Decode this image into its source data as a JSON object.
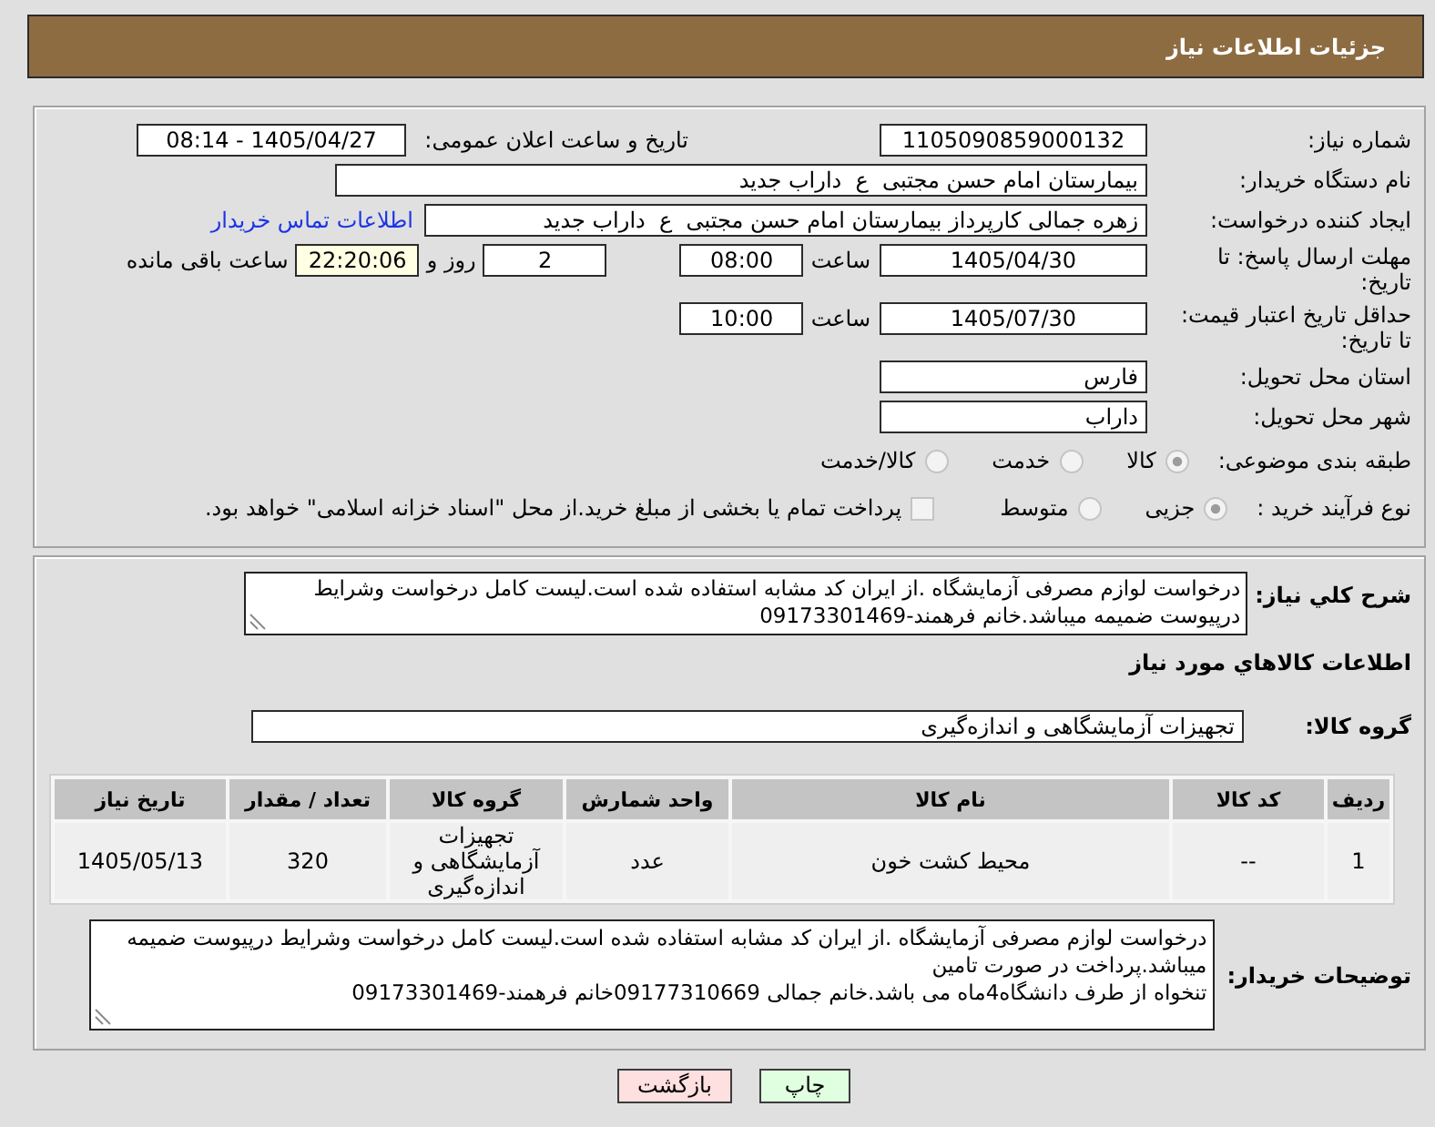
{
  "header": {
    "title": "جزئیات اطلاعات نیاز"
  },
  "details": {
    "need_number": {
      "label": "شماره نیاز:",
      "value": "1105090859000132"
    },
    "announcement": {
      "label": "تاریخ و ساعت اعلان عمومی:",
      "value": "1405/04/27 - 08:14"
    },
    "buyer_org": {
      "label": "نام دستگاه خریدار:",
      "value": "بیمارستان امام حسن مجتبی  ع  داراب جدید"
    },
    "requester": {
      "label": "ایجاد کننده درخواست:",
      "value": "زهره جمالی کارپرداز بیمارستان امام حسن مجتبی  ع  داراب جدید",
      "contact_link": "اطلاعات تماس خریدار"
    },
    "reply_deadline": {
      "label": "مهلت ارسال پاسخ: تا تاریخ:",
      "date": "1405/04/30",
      "time_label": "ساعت",
      "time": "08:00",
      "days": "2",
      "days_label": "روز و",
      "remaining": "22:20:06",
      "remaining_label": "ساعت باقی مانده"
    },
    "price_validity": {
      "label": "حداقل تاریخ اعتبار قیمت: تا تاریخ:",
      "date": "1405/07/30",
      "time_label": "ساعت",
      "time": "10:00"
    },
    "province": {
      "label": "استان محل تحویل:",
      "value": "فارس"
    },
    "city": {
      "label": "شهر محل تحویل:",
      "value": "داراب"
    },
    "category": {
      "label": "طبقه بندی موضوعی:",
      "options": [
        {
          "label": "کالا",
          "selected": true
        },
        {
          "label": "خدمت",
          "selected": false
        },
        {
          "label": "کالا/خدمت",
          "selected": false
        }
      ]
    },
    "process": {
      "label": "نوع فرآیند خرید :",
      "options": [
        {
          "label": "جزیی",
          "selected": true
        },
        {
          "label": "متوسط",
          "selected": false
        }
      ],
      "treasury_payment": {
        "label": "پرداخت تمام یا بخشی از مبلغ خرید.از محل \"اسناد خزانه اسلامی\" خواهد بود.",
        "checked": false
      }
    }
  },
  "description": {
    "label": "شرح کلي نياز:",
    "text": "درخواست لوازم مصرفی آزمایشگاه .از ایران کد مشابه استفاده شده است.لیست کامل درخواست وشرایط درپیوست ضمیمه میباشد.خانم فرهمند-09173301469"
  },
  "goods": {
    "title": "اطلاعات کالاهاي مورد نياز",
    "group_label": "گروه کالا:",
    "group": "تجهیزات آزمایشگاهی و اندازه‌گیری",
    "table": {
      "columns": [
        "ردیف",
        "کد کالا",
        "نام کالا",
        "واحد شمارش",
        "گروه کالا",
        "تعداد / مقدار",
        "تاریخ نیاز"
      ],
      "rows": [
        [
          "1",
          "--",
          "محیط کشت خون",
          "عدد",
          "تجهیزات آزمایشگاهی و اندازه‌گیری",
          "320",
          "1405/05/13"
        ]
      ]
    }
  },
  "buyer_notes": {
    "label": "توضیحات خریدار:",
    "text": "درخواست لوازم مصرفی آزمایشگاه .از ایران کد مشابه استفاده شده است.لیست کامل درخواست وشرایط درپیوست ضمیمه میباشد.پرداخت در صورت تامین\nتنخواه از طرف دانشگاه4ماه می باشد.خانم جمالی 09177310669خانم فرهمند-09173301469"
  },
  "buttons": [
    {
      "label": "چاپ",
      "kind": "print"
    },
    {
      "label": "بازگشت",
      "kind": "back"
    }
  ]
}
